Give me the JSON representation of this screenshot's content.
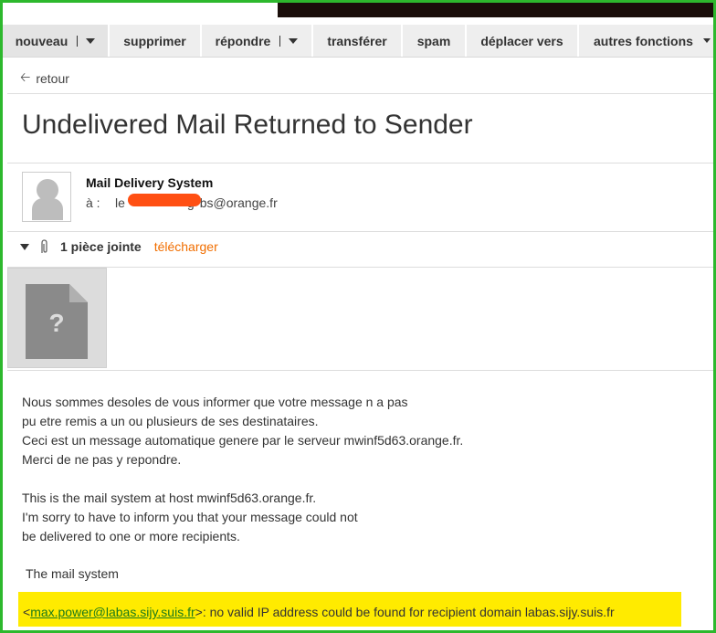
{
  "toolbar": {
    "items": [
      {
        "label": "nouveau",
        "split": true,
        "dropdown": true
      },
      {
        "label": "supprimer"
      },
      {
        "label": "répondre",
        "split": true,
        "dropdown": true
      },
      {
        "label": "transférer"
      },
      {
        "label": "spam"
      },
      {
        "label": "déplacer vers"
      },
      {
        "label": "autres fonctions",
        "dropdown": true
      }
    ]
  },
  "nav": {
    "back_label": "retour",
    "back_icon": "arrow-left-icon"
  },
  "message": {
    "subject": "Undelivered Mail Returned to Sender",
    "sender_name": "Mail Delivery System",
    "to_prefix": "à :",
    "to_address_start": "le",
    "to_address_mid": "g",
    "to_address_end": "bs@orange.fr"
  },
  "attachments": {
    "count_label": "1 pièce jointe",
    "download_label": "télécharger"
  },
  "body": {
    "lines_fr": [
      "Nous sommes desoles de vous informer que votre message n a pas",
      "pu etre remis a un ou plusieurs de ses destinataires.",
      "Ceci est un message automatique genere par le serveur mwinf5d63.orange.fr.",
      "Merci de ne pas y repondre."
    ],
    "lines_en": [
      "This is the mail system at host mwinf5d63.orange.fr.",
      "I'm sorry to have to inform you that your message could not",
      "be delivered to one or more recipients."
    ],
    "signature": "The mail system",
    "error_open": "<",
    "error_email": "max.power@labas.sijy.suis.fr",
    "error_rest": ">: no valid IP address could be found for recipient domain labas.sijy.suis.fr"
  },
  "colors": {
    "accent": "#f16e00",
    "highlight": "#ffeb00",
    "frame": "#2db82d",
    "link": "#1b7a1b"
  }
}
